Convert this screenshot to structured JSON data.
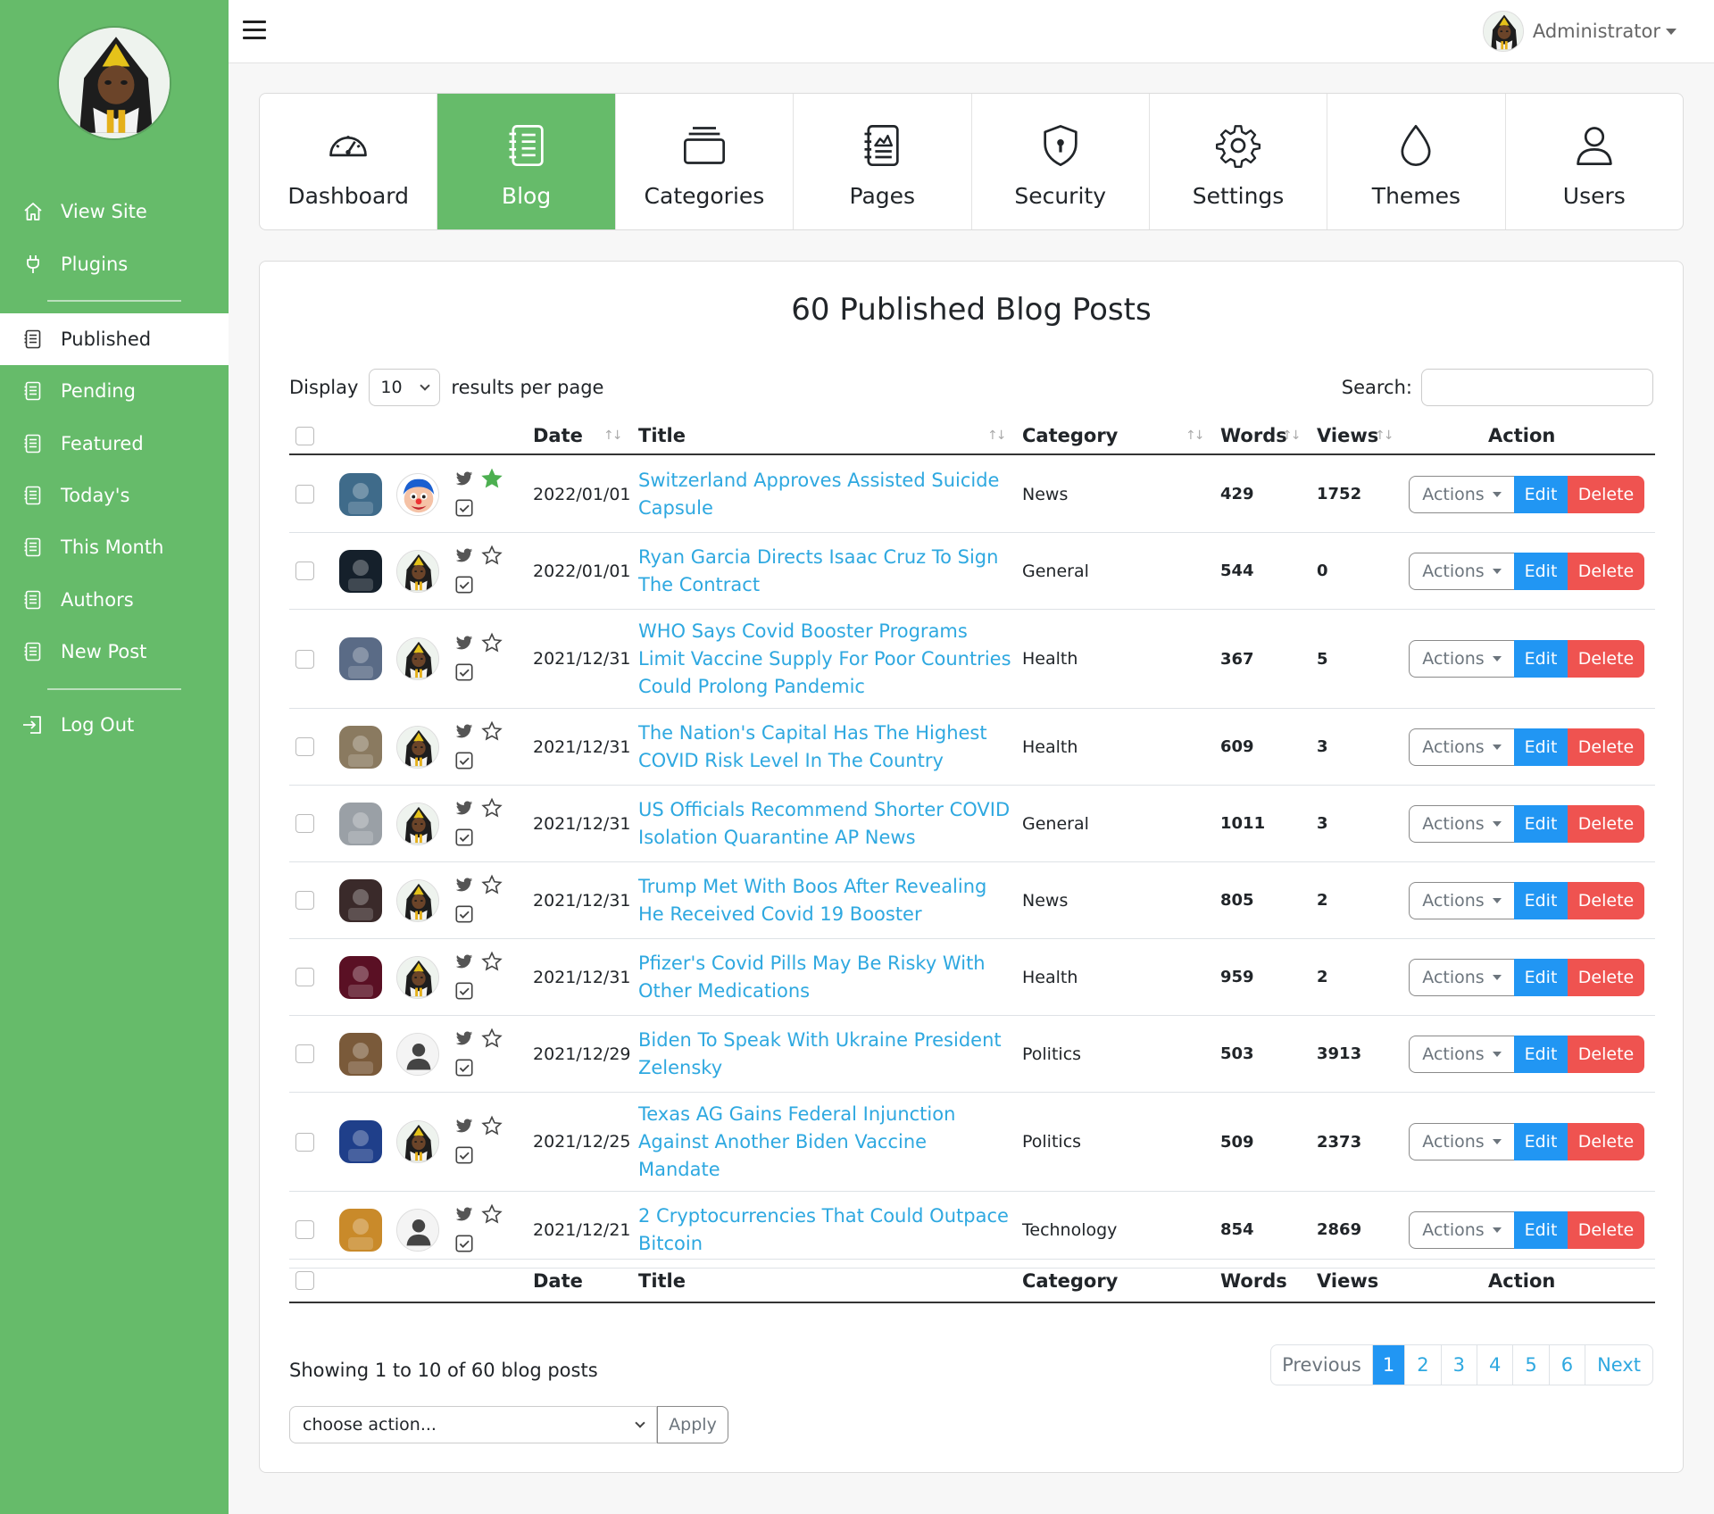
{
  "sidebar": {
    "items": [
      {
        "label": "View Site",
        "icon": "home-icon"
      },
      {
        "label": "Plugins",
        "icon": "plug-icon"
      },
      {
        "label": "Published",
        "icon": "document-icon"
      },
      {
        "label": "Pending",
        "icon": "document-icon"
      },
      {
        "label": "Featured",
        "icon": "document-icon"
      },
      {
        "label": "Today's",
        "icon": "document-icon"
      },
      {
        "label": "This Month",
        "icon": "document-icon"
      },
      {
        "label": "Authors",
        "icon": "document-icon"
      },
      {
        "label": "New Post",
        "icon": "document-icon"
      },
      {
        "label": "Log Out",
        "icon": "logout-icon"
      }
    ],
    "active_item": "Published"
  },
  "topbar": {
    "user_name": "Administrator"
  },
  "tabs": [
    {
      "label": "Dashboard",
      "icon": "gauge-icon"
    },
    {
      "label": "Blog",
      "icon": "notebook-icon"
    },
    {
      "label": "Categories",
      "icon": "stack-icon"
    },
    {
      "label": "Pages",
      "icon": "pages-icon"
    },
    {
      "label": "Security",
      "icon": "shield-icon"
    },
    {
      "label": "Settings",
      "icon": "gear-icon"
    },
    {
      "label": "Themes",
      "icon": "droplet-icon"
    },
    {
      "label": "Users",
      "icon": "user-icon"
    }
  ],
  "active_tab": "Blog",
  "main": {
    "title": "60 Published Blog Posts",
    "display_label": "Display",
    "per_page": "10",
    "per_page_suffix": "results per page",
    "search_label": "Search:",
    "search_value": ""
  },
  "table": {
    "headers": {
      "date": "Date",
      "title": "Title",
      "category": "Category",
      "words": "Words",
      "views": "Views",
      "action": "Action"
    },
    "rows": [
      {
        "date": "2022/01/01",
        "title": "Switzerland Approves Assisted Suicide Capsule",
        "category": "News",
        "words": "429",
        "views": "1752",
        "featured": true,
        "author_avatar": "clown-avatar",
        "thumb_color": "#3f6b8a"
      },
      {
        "date": "2022/01/01",
        "title": "Ryan Garcia Directs Isaac Cruz To Sign The Contract",
        "category": "General",
        "words": "544",
        "views": "0",
        "featured": false,
        "author_avatar": "hooded-avatar",
        "thumb_color": "#15202b"
      },
      {
        "date": "2021/12/31",
        "title": "WHO Says Covid Booster Programs Limit Vaccine Supply For Poor Countries Could Prolong Pandemic",
        "category": "Health",
        "words": "367",
        "views": "5",
        "featured": false,
        "author_avatar": "hooded-avatar",
        "thumb_color": "#5a6b86"
      },
      {
        "date": "2021/12/31",
        "title": "The Nation's Capital Has The Highest COVID Risk Level In The Country",
        "category": "Health",
        "words": "609",
        "views": "3",
        "featured": false,
        "author_avatar": "hooded-avatar",
        "thumb_color": "#8a7a60"
      },
      {
        "date": "2021/12/31",
        "title": "US Officials Recommend Shorter COVID Isolation Quarantine AP News",
        "category": "General",
        "words": "1011",
        "views": "3",
        "featured": false,
        "author_avatar": "hooded-avatar",
        "thumb_color": "#9aa0a6"
      },
      {
        "date": "2021/12/31",
        "title": "Trump Met With Boos After Revealing He Received Covid 19 Booster",
        "category": "News",
        "words": "805",
        "views": "2",
        "featured": false,
        "author_avatar": "hooded-avatar",
        "thumb_color": "#3a2a2a"
      },
      {
        "date": "2021/12/31",
        "title": "Pfizer's Covid Pills May Be Risky With Other Medications",
        "category": "Health",
        "words": "959",
        "views": "2",
        "featured": false,
        "author_avatar": "hooded-avatar",
        "thumb_color": "#5a1024"
      },
      {
        "date": "2021/12/29",
        "title": "Biden To Speak With Ukraine President Zelensky",
        "category": "Politics",
        "words": "503",
        "views": "3913",
        "featured": false,
        "author_avatar": "default-user-avatar",
        "thumb_color": "#7a5a3a"
      },
      {
        "date": "2021/12/25",
        "title": "Texas AG Gains Federal Injunction Against Another Biden Vaccine Mandate",
        "category": "Politics",
        "words": "509",
        "views": "2373",
        "featured": false,
        "author_avatar": "hooded-avatar",
        "thumb_color": "#1f3f8a"
      },
      {
        "date": "2021/12/21",
        "title": "2 Cryptocurrencies That Could Outpace Bitcoin",
        "category": "Technology",
        "words": "854",
        "views": "2869",
        "featured": false,
        "author_avatar": "default-user-avatar",
        "thumb_color": "#c98a2a"
      }
    ],
    "actions_label": "Actions",
    "edit_label": "Edit",
    "delete_label": "Delete"
  },
  "footer": {
    "showing": "Showing 1 to 10 of 60 blog posts",
    "pagination": [
      "Previous",
      "1",
      "2",
      "3",
      "4",
      "5",
      "6",
      "Next"
    ],
    "active_page": "1",
    "bulk_placeholder": "choose action...",
    "apply_label": "Apply"
  },
  "colors": {
    "sidebar_green": "#66bb6a",
    "link_blue": "#2ea8e0",
    "edit_blue": "#2196f3",
    "delete_red": "#ef5350"
  }
}
